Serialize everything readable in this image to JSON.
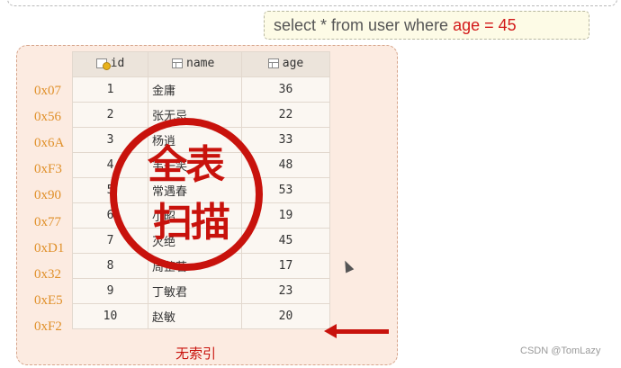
{
  "sql": {
    "prefix": "select * from user where",
    "highlight": "age = 45"
  },
  "table": {
    "columns": [
      {
        "key": "id",
        "label": "id",
        "icon": "primary-key-icon"
      },
      {
        "key": "name",
        "label": "name",
        "icon": "column-icon"
      },
      {
        "key": "age",
        "label": "age",
        "icon": "column-icon"
      }
    ],
    "addresses": [
      "0x07",
      "0x56",
      "0x6A",
      "0xF3",
      "0x90",
      "0x77",
      "0xD1",
      "0x32",
      "0xE5",
      "0xF2"
    ],
    "rows": [
      {
        "id": "1",
        "name": "金庸",
        "age": "36"
      },
      {
        "id": "2",
        "name": "张无忌",
        "age": "22"
      },
      {
        "id": "3",
        "name": "杨逍",
        "age": "33"
      },
      {
        "id": "4",
        "name": "韦一笑",
        "age": "48"
      },
      {
        "id": "5",
        "name": "常遇春",
        "age": "53"
      },
      {
        "id": "6",
        "name": "小昭",
        "age": "19"
      },
      {
        "id": "7",
        "name": "灭绝",
        "age": "45"
      },
      {
        "id": "8",
        "name": "周芷若",
        "age": "17"
      },
      {
        "id": "9",
        "name": "丁敏君",
        "age": "23"
      },
      {
        "id": "10",
        "name": "赵敏",
        "age": "20"
      }
    ]
  },
  "stamp": {
    "line1": "全表",
    "line2": "扫描"
  },
  "caption": "无索引",
  "watermark": "CSDN @TomLazy",
  "colors": {
    "accent_red": "#c8120c",
    "address_orange": "#e0902a",
    "panel_bg": "#fcebe1"
  }
}
